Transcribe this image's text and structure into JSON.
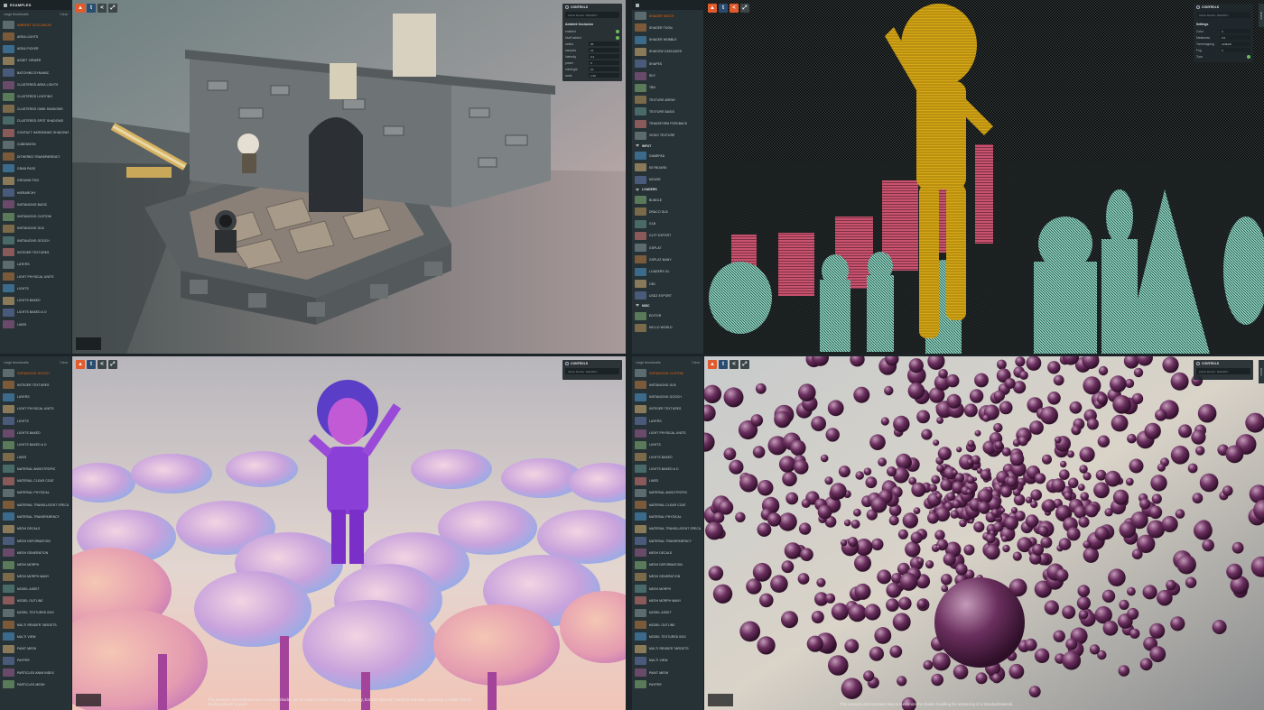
{
  "panels": [
    {
      "sidebar": {
        "title": "EXAMPLES",
        "sub_label": "Large thumbnails",
        "sub_right": "Clear",
        "items": [
          {
            "label": "AMBIENT OCCLUSION",
            "active": true
          },
          {
            "label": "AREA LIGHTS"
          },
          {
            "label": "AREA PICKER"
          },
          {
            "label": "ASSET VIEWER"
          },
          {
            "label": "BATCHING DYNAMIC"
          },
          {
            "label": "CLUSTERED AREA LIGHTS"
          },
          {
            "label": "CLUSTERED LIGHTING"
          },
          {
            "label": "CLUSTERED OMNI SHADOWS"
          },
          {
            "label": "CLUSTERED SPOT SHADOWS"
          },
          {
            "label": "CONTACT HARDENING SHADOWS"
          },
          {
            "label": "CUBEMOON"
          },
          {
            "label": "DITHERED TRANSPARENCY"
          },
          {
            "label": "GRAB PASS"
          },
          {
            "label": "GROUND FOG"
          },
          {
            "label": "HIERARCHY"
          },
          {
            "label": "INSTANCING BASIC"
          },
          {
            "label": "INSTANCING CUSTOM"
          },
          {
            "label": "INSTANCING GLB"
          },
          {
            "label": "INSTANCING GOOCH"
          },
          {
            "label": "INTEGER TEXTURES"
          },
          {
            "label": "LAYERS"
          },
          {
            "label": "LIGHT PHYSICAL UNITS"
          },
          {
            "label": "LIGHTS"
          },
          {
            "label": "LIGHTS BAKED"
          },
          {
            "label": "LIGHTS BAKED A O"
          },
          {
            "label": "LINES"
          }
        ]
      },
      "controls": {
        "title": "CONTROLS",
        "device": "Active Device: WebGPU",
        "section": "Ambient Occlusion",
        "rows": [
          {
            "label": "enabled",
            "type": "check"
          },
          {
            "label": "blurEnabled",
            "type": "check"
          },
          {
            "label": "radius",
            "value": "30"
          },
          {
            "label": "samples",
            "value": "12"
          },
          {
            "label": "intensity",
            "value": "0.4"
          },
          {
            "label": "power",
            "value": "6"
          },
          {
            "label": "minAngle",
            "value": "10"
          },
          {
            "label": "scale",
            "value": "1.00"
          }
        ]
      }
    },
    {
      "sidebar": {
        "sub_label": "",
        "items": [
          {
            "label": "SHADER HATCH",
            "active": true
          },
          {
            "label": "SHADER TOON"
          },
          {
            "label": "SHADER WOBBLE"
          },
          {
            "label": "SHADOW CASCADES"
          },
          {
            "label": "SHAPES"
          },
          {
            "label": "SKY"
          },
          {
            "label": "TBN"
          },
          {
            "label": "TEXTURE ARRAY"
          },
          {
            "label": "TEXTURE BASIS"
          },
          {
            "label": "TRANSFORM FEEDBACK"
          },
          {
            "label": "VIDEO TEXTURE"
          },
          {
            "label": "INPUT",
            "category": true
          },
          {
            "label": "GAMEPAD"
          },
          {
            "label": "KEYBOARD"
          },
          {
            "label": "MOUSE"
          },
          {
            "label": "LOADERS",
            "category": true
          },
          {
            "label": "BUNDLE"
          },
          {
            "label": "DRACO GLB"
          },
          {
            "label": "GLB"
          },
          {
            "label": "GLTF EXPORT"
          },
          {
            "label": "GSPLAT"
          },
          {
            "label": "GSPLAT MANY"
          },
          {
            "label": "LOADERS GL"
          },
          {
            "label": "OBJ"
          },
          {
            "label": "USDZ EXPORT"
          },
          {
            "label": "MISC",
            "category": true
          },
          {
            "label": "EDITOR"
          },
          {
            "label": "HELLO WORLD"
          }
        ]
      },
      "controls": {
        "title": "CONTROLS",
        "device": "Active Device: WebGPU",
        "section": "Settings",
        "rows": [
          {
            "label": "Color",
            "value": "0"
          },
          {
            "label": "Metalness",
            "value": "0.5"
          },
          {
            "label": "Tonemapping",
            "value": "LINEAR"
          },
          {
            "label": "Fog",
            "value": "0"
          },
          {
            "label": "Toon",
            "type": "check"
          }
        ]
      }
    },
    {
      "sidebar": {
        "sub_label": "Large thumbnails",
        "sub_right": "Clear",
        "items": [
          {
            "label": "INSTANCING GOOCH",
            "active": true
          },
          {
            "label": "INTEGER TEXTURES"
          },
          {
            "label": "LAYERS"
          },
          {
            "label": "LIGHT PHYSICAL UNITS"
          },
          {
            "label": "LIGHTS"
          },
          {
            "label": "LIGHTS BAKED"
          },
          {
            "label": "LIGHTS BAKED A O"
          },
          {
            "label": "LINES"
          },
          {
            "label": "MATERIAL ANISOTROPIC"
          },
          {
            "label": "MATERIAL CLEAR COAT"
          },
          {
            "label": "MATERIAL PHYSICAL"
          },
          {
            "label": "MATERIAL TRANSLUCENT SPECULAR"
          },
          {
            "label": "MATERIAL TRANSPARENCY"
          },
          {
            "label": "MESH DECALS"
          },
          {
            "label": "MESH DEFORMATION"
          },
          {
            "label": "MESH GENERATION"
          },
          {
            "label": "MESH MORPH"
          },
          {
            "label": "MESH MORPH MANY"
          },
          {
            "label": "MODEL ASSET"
          },
          {
            "label": "MODEL OUTLINE"
          },
          {
            "label": "MODEL TEXTURED BOX"
          },
          {
            "label": "MULTI RENDER TARGETS"
          },
          {
            "label": "MULTI VIEW"
          },
          {
            "label": "PAINT MESH"
          },
          {
            "label": "PAYPER"
          },
          {
            "label": "PARTICLES ANIM INDEX"
          },
          {
            "label": "PARTICLES MESH"
          }
        ]
      },
      "controls": {
        "title": "CONTROLS",
        "device": "Active Device: WebGPU",
        "rows": []
      },
      "caption": "This example demonstrates how a custom shader can be used to render instanced geometry, but also skinned, morphed and static geometry. A simple Gooch shading shader is used."
    },
    {
      "sidebar": {
        "sub_label": "Large thumbnails",
        "sub_right": "Clear",
        "items": [
          {
            "label": "INSTANCING CUSTOM",
            "active": true
          },
          {
            "label": "INSTANCING GLB"
          },
          {
            "label": "INSTANCING GOOCH"
          },
          {
            "label": "INTEGER TEXTURES"
          },
          {
            "label": "LAYERS"
          },
          {
            "label": "LIGHT PHYSICAL UNITS"
          },
          {
            "label": "LIGHTS"
          },
          {
            "label": "LIGHTS BAKED"
          },
          {
            "label": "LIGHTS BAKED A O"
          },
          {
            "label": "LINES"
          },
          {
            "label": "MATERIAL ANISOTROPIC"
          },
          {
            "label": "MATERIAL CLEAR COAT"
          },
          {
            "label": "MATERIAL PHYSICAL"
          },
          {
            "label": "MATERIAL TRANSLUCENT SPECULAR"
          },
          {
            "label": "MATERIAL TRANSPARENCY"
          },
          {
            "label": "MESH DECALS"
          },
          {
            "label": "MESH DEFORMATION"
          },
          {
            "label": "MESH GENERATION"
          },
          {
            "label": "MESH MORPH"
          },
          {
            "label": "MESH MORPH MANY"
          },
          {
            "label": "MODEL ASSET"
          },
          {
            "label": "MODEL OUTLINE"
          },
          {
            "label": "MODEL TEXTURED BOX"
          },
          {
            "label": "MULTI RENDER TARGETS"
          },
          {
            "label": "MULTI VIEW"
          },
          {
            "label": "PAINT MESH"
          },
          {
            "label": "PAYPER"
          }
        ]
      },
      "controls": {
        "title": "CONTROLS",
        "device": "Active Device: WebGPU",
        "rows": []
      },
      "caption": "This example demonstrates how to customize the shader handling the instancing of a StandardMaterial."
    }
  ],
  "side_tab_label": "DOCS",
  "colors": {
    "accent": "#ff6600",
    "sidebar_bg": "#263236",
    "panel_bg": "#202a2d"
  }
}
